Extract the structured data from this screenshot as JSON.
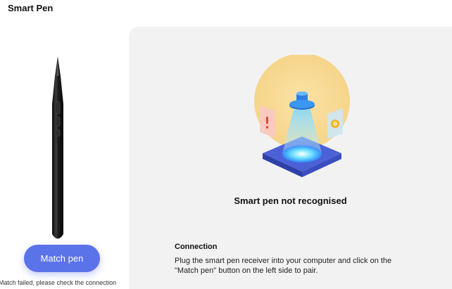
{
  "page": {
    "title": "Smart Pen"
  },
  "left": {
    "match_button_label": "Match pen",
    "match_status": "Match failed, please check the connection",
    "pen_image": "smart-pen-illustration"
  },
  "right": {
    "illustration": "pen-receiver-not-found-illustration",
    "status_title": "Smart pen not recognised",
    "connection_title": "Connection",
    "connection_text": "Plug the smart pen receiver into your computer and click on the \"Match pen\" button on the left side to pair."
  },
  "colors": {
    "accent": "#5b73e8",
    "panel_bg": "#f2f2f2",
    "warning_red": "#e0463e",
    "warning_amber": "#f2b424"
  }
}
